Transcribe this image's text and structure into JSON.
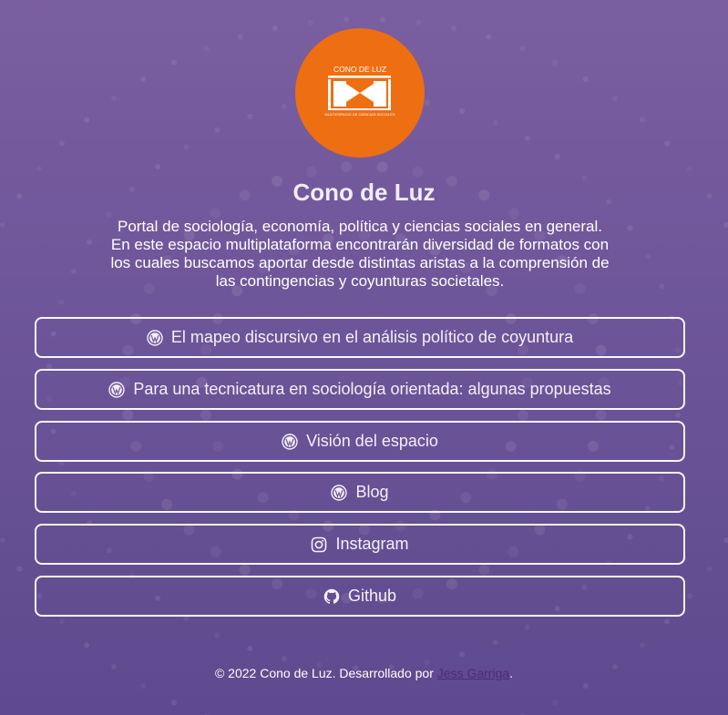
{
  "logo": {
    "alt": "Cono de Luz logo",
    "brand_color": "#ee6e12",
    "top_text": "CONO DE LUZ",
    "bottom_text": "MULTIESPACIO DE CIENCIAS SOCIALES"
  },
  "profile": {
    "title": "Cono de Luz",
    "description": "Portal de sociología, economía, política y ciencias sociales en general. En este espacio multiplataforma encontrarán diversidad de formatos con los cuales buscamos aportar desde distintas aristas a la comprensión de las contingencias y coyunturas societales."
  },
  "links": [
    {
      "label": "El mapeo discursivo en el análisis político de coyuntura",
      "icon": "wordpress-icon"
    },
    {
      "label": "Para una tecnicatura en sociología orientada: algunas propuestas",
      "icon": "wordpress-icon"
    },
    {
      "label": "Visión del espacio",
      "icon": "wordpress-icon"
    },
    {
      "label": "Blog",
      "icon": "wordpress-icon"
    },
    {
      "label": "Instagram",
      "icon": "instagram-icon"
    },
    {
      "label": "Github",
      "icon": "github-icon"
    }
  ],
  "footer": {
    "text": "© 2022 Cono de Luz. Desarrollado por",
    "author_link": "Jess Garriga",
    "trailing": "."
  },
  "colors": {
    "background": "#6f569a",
    "link_border": "#ffffff",
    "author_link": "#4a2b7a"
  }
}
